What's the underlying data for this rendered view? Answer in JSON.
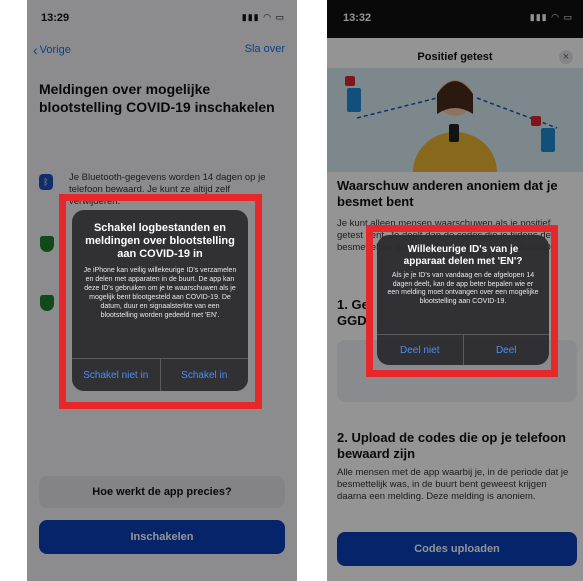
{
  "left": {
    "status_time": "13:29",
    "nav_back": "Vorige",
    "nav_skip": "Sla over",
    "title": "Meldingen over mogelijke blootstelling COVID-19 inschakelen",
    "bluetooth_text": "Je Bluetooth-gegevens worden 14 dagen op je telefoon bewaard. Je kunt ze altijd zelf verwijderen.",
    "alert": {
      "title": "Schakel logbestanden en meldingen over blootstelling aan COVID-19 in",
      "message": "Je iPhone kan veilig willekeurige ID's verzamelen en delen met apparaten in de buurt. De app kan deze ID's gebruiken om je te waarschuwen als je mogelijk bent blootgesteld aan COVID-19. De datum, duur en signaalsterkte van een blootstelling worden gedeeld met 'EN'.",
      "cancel": "Schakel niet in",
      "confirm": "Schakel in"
    },
    "how_button": "Hoe werkt de app precies?",
    "enable_button": "Inschakelen"
  },
  "right": {
    "status_time": "13:32",
    "sheet_title": "Positief getest",
    "close": "×",
    "heading1": "Waarschuw anderen anoniem dat je besmet bent",
    "body1": "Je kunt alleen mensen waarschuwen als je positief getest bent. Je deelt dan de codes die je tijdens de besmettelijke periode hebt ontvangen aan de GGD.",
    "step1_visible": "1. Ge",
    "step1_line2": "GGD",
    "alert": {
      "title": "Willekeurige ID's van je apparaat delen met 'EN'?",
      "message": "Als je je ID's van vandaag en de afgelopen 14 dagen deelt, kan de app beter bepalen wie er een melding moet ontvangen over een mogelijke blootstelling aan COVID-19.",
      "cancel": "Deel niet",
      "confirm": "Deel"
    },
    "heading2": "2. Upload de codes die op je telefoon bewaard zijn",
    "body2": "Alle mensen met de app waarbij je, in de periode dat je besmettelijk was, in de buurt bent geweest krijgen daarna een melding. Deze melding is anoniem.",
    "upload_button": "Codes uploaden"
  },
  "colors": {
    "accent": "#0a3fb5",
    "highlight": "#e8272b",
    "ios_link": "#4b8df8"
  }
}
